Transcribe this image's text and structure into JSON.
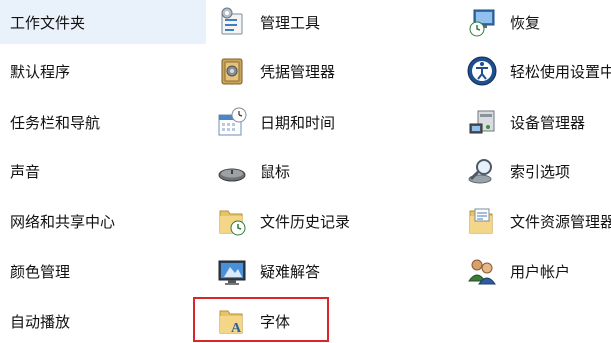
{
  "columns": [
    {
      "items": [
        {
          "label": "工作文件夹",
          "selected": true
        },
        {
          "label": "默认程序"
        },
        {
          "label": "任务栏和导航"
        },
        {
          "label": "声音"
        },
        {
          "label": "网络和共享中心"
        },
        {
          "label": "颜色管理"
        },
        {
          "label": "自动播放"
        }
      ]
    },
    {
      "items": [
        {
          "label": "管理工具",
          "icon": "admin-tools-icon"
        },
        {
          "label": "凭据管理器",
          "icon": "credential-manager-icon"
        },
        {
          "label": "日期和时间",
          "icon": "date-time-icon"
        },
        {
          "label": "鼠标",
          "icon": "mouse-icon"
        },
        {
          "label": "文件历史记录",
          "icon": "file-history-icon"
        },
        {
          "label": "疑难解答",
          "icon": "troubleshooting-icon"
        },
        {
          "label": "字体",
          "icon": "fonts-folder-icon",
          "highlighted": true
        }
      ]
    },
    {
      "items": [
        {
          "label": "恢复",
          "icon": "recovery-icon"
        },
        {
          "label": "轻松使用设置中心",
          "icon": "ease-of-access-icon"
        },
        {
          "label": "设备管理器",
          "icon": "device-manager-icon"
        },
        {
          "label": "索引选项",
          "icon": "indexing-options-icon"
        },
        {
          "label": "文件资源管理器选项",
          "icon": "file-explorer-options-icon"
        },
        {
          "label": "用户帐户",
          "icon": "user-accounts-icon"
        }
      ]
    }
  ],
  "colors": {
    "selected_background": "#e9f2fb",
    "highlight_border": "#d9262a"
  }
}
